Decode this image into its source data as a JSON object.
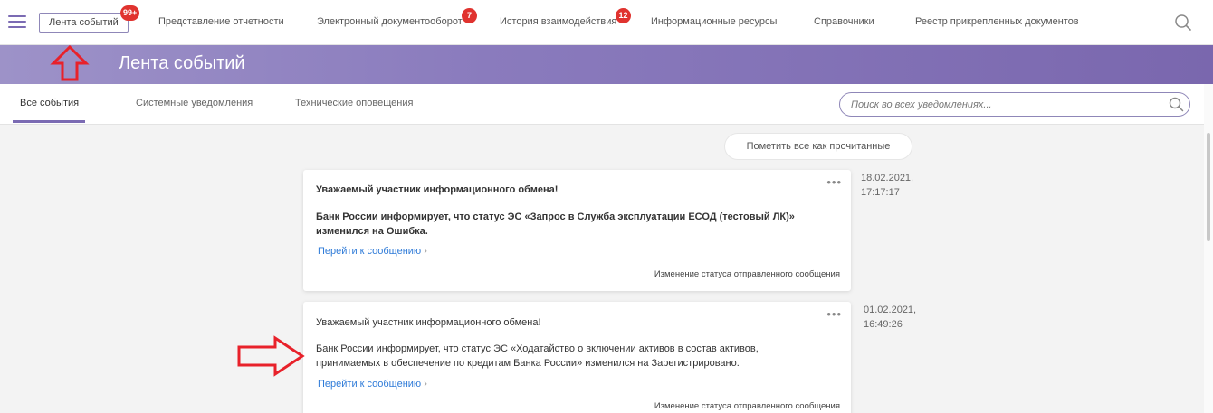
{
  "nav": {
    "items": [
      {
        "label": "Лента событий",
        "badge": "99+"
      },
      {
        "label": "Представление отчетности"
      },
      {
        "label": "Электронный документооборот",
        "badge": "7"
      },
      {
        "label": "История взаимодействия",
        "badge": "12"
      },
      {
        "label": "Информационные ресурсы"
      },
      {
        "label": "Справочники"
      },
      {
        "label": "Реестр прикрепленных документов"
      }
    ],
    "menu_icon": "hamburger-icon",
    "search_icon": "search-icon"
  },
  "banner": {
    "title": "Лента событий"
  },
  "tabs": [
    {
      "label": "Все события",
      "active": true
    },
    {
      "label": "Системные уведомления"
    },
    {
      "label": "Технические оповещения"
    }
  ],
  "search": {
    "placeholder": "Поиск во всех уведомлениях..."
  },
  "mark_all_read": "Пометить все как прочитанные",
  "events": [
    {
      "greeting": "Уважаемый участник информационного обмена!",
      "body": "Банк России информирует, что статус ЭС «Запрос в Служба эксплуатации ЕСОД (тестовый ЛК)» изменился на Ошибка.",
      "link": "Перейти к сообщению",
      "category": "Изменение статуса отправленного сообщения",
      "date": "18.02.2021,",
      "time": "17:17:17",
      "unread": true
    },
    {
      "greeting": "Уважаемый участник информационного обмена!",
      "body": "Банк России информирует, что статус ЭС «Ходатайство о включении активов в состав активов, принимаемых в обеспечение по кредитам Банка России» изменился на Зарегистрировано.",
      "link": "Перейти к сообщению",
      "category": "Изменение статуса отправленного сообщения",
      "date": "01.02.2021,",
      "time": "16:49:26",
      "unread": false
    }
  ],
  "colors": {
    "accent": "#7b6bb3",
    "badge": "#e0332f",
    "link": "#2f7bd8",
    "annotation_arrow": "#e8212a"
  }
}
